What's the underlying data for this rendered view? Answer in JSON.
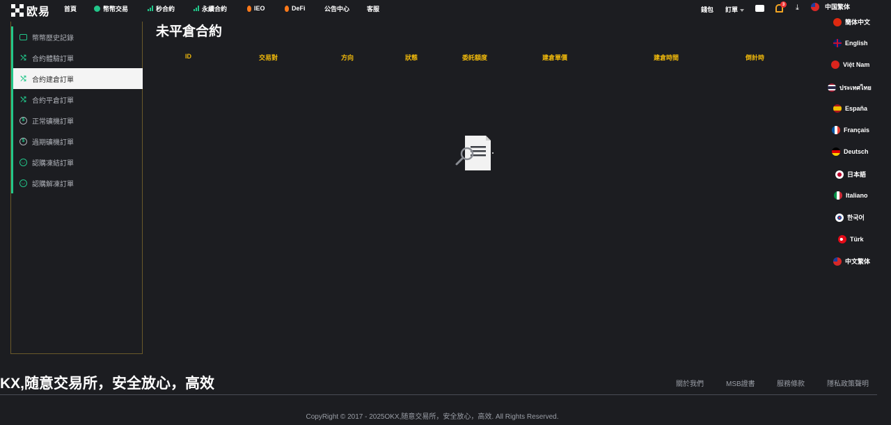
{
  "brand": {
    "name": "欧易"
  },
  "nav": [
    {
      "label": "首頁",
      "icon": "none"
    },
    {
      "label": "幣幣交易",
      "icon": "coin-icon"
    },
    {
      "label": "秒合約",
      "icon": "chart-bars-icon"
    },
    {
      "label": "永續合約",
      "icon": "chart-bars-icon"
    },
    {
      "label": "IEO",
      "icon": "flame-icon"
    },
    {
      "label": "DeFi",
      "icon": "flame-icon"
    },
    {
      "label": "公告中心",
      "icon": "none"
    },
    {
      "label": "客服",
      "icon": "none"
    }
  ],
  "header_right": {
    "wallet": "錢包",
    "orders": "訂單",
    "notification_count": "3",
    "language": "中国繁体"
  },
  "sidebar": {
    "items": [
      {
        "label": "幣幣歷史記錄",
        "icon": "wallet-icon"
      },
      {
        "label": "合約體驗訂單",
        "icon": "swap-icon"
      },
      {
        "label": "合約建倉訂單",
        "icon": "swap-icon"
      },
      {
        "label": "合約平倉訂單",
        "icon": "swap-icon"
      },
      {
        "label": "正常礦機訂單",
        "icon": "dollar-coin-icon"
      },
      {
        "label": "過期礦機訂單",
        "icon": "dollar-coin-icon"
      },
      {
        "label": "認購凍結訂單",
        "icon": "headset-icon"
      },
      {
        "label": "認購解凍訂單",
        "icon": "headset-icon"
      }
    ],
    "active": "合約建倉訂單"
  },
  "main": {
    "title": "未平倉合約",
    "columns": [
      "ID",
      "交易對",
      "方向",
      "狀態",
      "委託額度",
      "建倉單價",
      "建倉時間",
      "倒計時"
    ],
    "empty_icon": "no-data-icon"
  },
  "languages": [
    {
      "label": "簡体中文",
      "flag": "cn-flag"
    },
    {
      "label": "English",
      "flag": "uk-flag"
    },
    {
      "label": "Việt Nam",
      "flag": "vn-flag"
    },
    {
      "label": "ประเทศไทย",
      "flag": "th-flag"
    },
    {
      "label": "España",
      "flag": "es-flag"
    },
    {
      "label": "Français",
      "flag": "fr-flag"
    },
    {
      "label": "Deutsch",
      "flag": "de-flag"
    },
    {
      "label": "日本語",
      "flag": "jp-flag"
    },
    {
      "label": "Italiano",
      "flag": "it-flag"
    },
    {
      "label": "한국어",
      "flag": "kr-flag"
    },
    {
      "label": "Türk",
      "flag": "tr-flag"
    },
    {
      "label": "中文繁体",
      "flag": "tw-flag"
    }
  ],
  "footer": {
    "slogan": "KX,随意交易所，安全放心，高效",
    "links": [
      "關於我們",
      "MSB證書",
      "服務條款",
      "隱私政策聲明"
    ],
    "copyright": "CopyRight © 2017 - 2025OKX,随意交易所，安全放心，高效. All Rights Reserved."
  },
  "colors": {
    "background": "#1c1d21",
    "accent_green": "#22c68a",
    "table_header": "#f0b90b",
    "notification": "#e33333"
  }
}
